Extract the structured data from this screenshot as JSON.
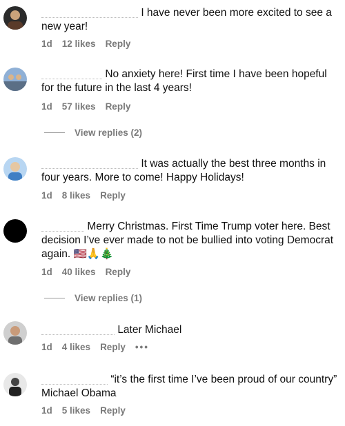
{
  "comments": [
    {
      "text": "I have never been more excited to see a new year!",
      "age": "1d",
      "likes": "12 likes",
      "reply": "Reply"
    },
    {
      "text": "No anxiety here! First time I have been hopeful for the future in the last 4 years!",
      "age": "1d",
      "likes": "57 likes",
      "reply": "Reply",
      "view_replies": "View replies (2)"
    },
    {
      "text": "It was actually the best three months in four years. More to come! Happy Holidays!",
      "age": "1d",
      "likes": "8 likes",
      "reply": "Reply"
    },
    {
      "text": "Merry Christmas. First Time Trump voter here. Best decision I’ve ever made to not be bullied into voting Democrat again.",
      "emoji": "🇺🇸🙏🎄",
      "age": "1d",
      "likes": "40 likes",
      "reply": "Reply",
      "view_replies": "View replies (1)"
    },
    {
      "text": "Later Michael",
      "age": "1d",
      "likes": "4 likes",
      "reply": "Reply",
      "more": "•••"
    },
    {
      "text": "“it’s the first time I’ve been proud of our country” Michael Obama",
      "age": "1d",
      "likes": "5 likes",
      "reply": "Reply"
    }
  ],
  "colors": {
    "meta_gray": "#7a7a7a",
    "avatar_black": "#000000"
  }
}
